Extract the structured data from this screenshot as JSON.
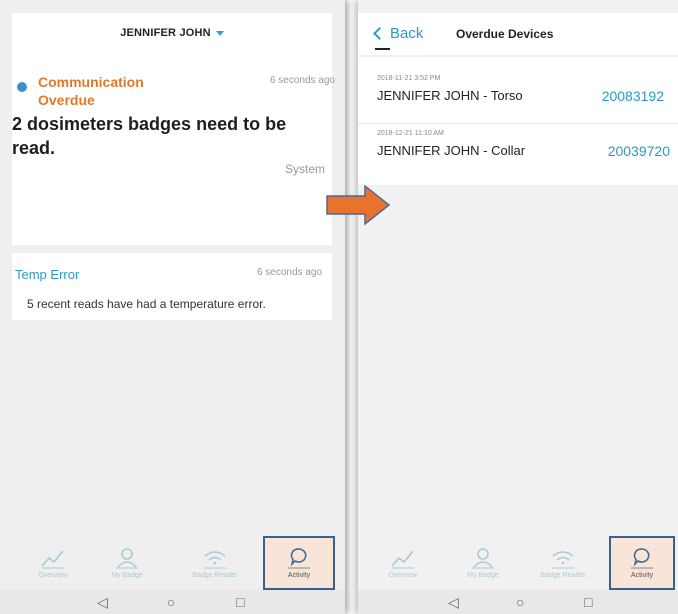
{
  "left_screen": {
    "user_name": "JENNIFER JOHN",
    "notifications": [
      {
        "title": "Communication Overdue",
        "time": "6 seconds ago",
        "message": "2 dosimeters badges need to be read.",
        "source": "System"
      },
      {
        "title": "Temp Error",
        "time": "6 seconds ago",
        "message": "5 recent reads have had a temperature error."
      }
    ]
  },
  "right_screen": {
    "back_label": "Back",
    "title": "Overdue Devices",
    "devices": [
      {
        "date": "2018-11-21 3:52 PM",
        "name": "JENNIFER JOHN - Torso",
        "id": "20083192"
      },
      {
        "date": "2018-12-21 11:10 AM",
        "name": "JENNIFER JOHN - Collar",
        "id": "20039720"
      }
    ]
  },
  "nav": {
    "items": [
      {
        "label": "Overview",
        "icon": "chart-line-icon"
      },
      {
        "label": "My Badge",
        "icon": "person-icon"
      },
      {
        "label": "Badge Reader",
        "icon": "wifi-icon"
      },
      {
        "label": "Activity",
        "icon": "speech-bubble-icon",
        "active": true
      }
    ]
  },
  "system_nav": {
    "back": "◁",
    "home": "○",
    "recents": "□"
  },
  "colors": {
    "accent": "#2e9ac0",
    "alert_orange": "#e07a2a",
    "arrow": "#e8722e",
    "active_tab_bg": "#f9e4d8",
    "highlight_border": "#3a5f92"
  }
}
